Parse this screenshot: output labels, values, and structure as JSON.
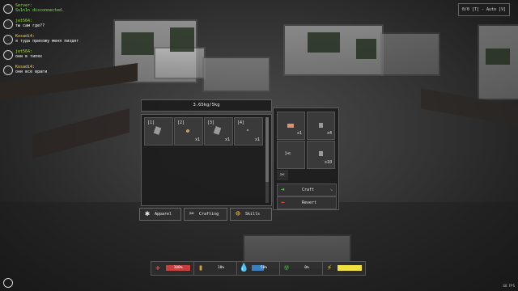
{
  "chat": [
    {
      "name": "Server:",
      "message": "Sv1n1n disconnected.",
      "name_color": "#9bdd3a",
      "msg_color": "#7ce85a"
    },
    {
      "name": "jet564:",
      "message": "ты сам где??",
      "name_color": "#9bdd3a",
      "msg_color": "#ffffff"
    },
    {
      "name": "Kosadi4:",
      "message": "я туда прихожу меня пиздят",
      "name_color": "#ffd24a",
      "msg_color": "#ffffff"
    },
    {
      "name": "jet564:",
      "message": "они в типях",
      "name_color": "#9bdd3a",
      "msg_color": "#ffffff"
    },
    {
      "name": "Kosadi4:",
      "message": "они все враги",
      "name_color": "#ffd24a",
      "msg_color": "#ffffff"
    }
  ],
  "hotkey_hint": "0/0 [T] - Auto [V]",
  "inventory": {
    "weight": "3.65kg/5kg",
    "slots": [
      {
        "index": "[1]",
        "qty": ""
      },
      {
        "index": "[2]",
        "qty": "x1"
      },
      {
        "index": "[3]",
        "qty": "x1"
      },
      {
        "index": "[4]",
        "qty": "x1"
      }
    ]
  },
  "tabs": [
    {
      "label": "Apparel",
      "icon": "person-icon"
    },
    {
      "label": "Crafting",
      "icon": "tools-icon"
    },
    {
      "label": "Skills",
      "icon": "target-icon"
    }
  ],
  "crafting": {
    "slots": [
      {
        "qty": "x1"
      },
      {
        "qty": "x4"
      },
      {
        "qty": ""
      },
      {
        "qty": "x10"
      }
    ],
    "craft_label": "Craft",
    "revert_label": "Revert"
  },
  "stats": [
    {
      "name": "health",
      "value": "100%",
      "icon": "health-cross-icon",
      "color": "#c74040"
    },
    {
      "name": "food",
      "value": "18%",
      "icon": "food-icon",
      "color": "#b88a30"
    },
    {
      "name": "water",
      "value": "50%",
      "icon": "water-drop-icon",
      "color": "#3a80c0"
    },
    {
      "name": "radiation",
      "value": "0%",
      "icon": "radiation-icon",
      "color": "#4aa040"
    },
    {
      "name": "stamina",
      "value": "",
      "icon": "lightning-icon",
      "color": "#f0e040"
    }
  ],
  "fps": "60 FPS"
}
